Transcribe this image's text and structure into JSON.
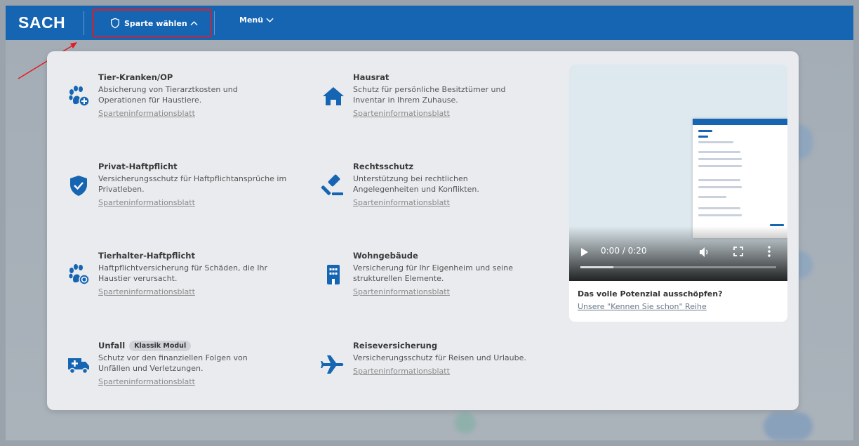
{
  "header": {
    "brand": "SACH",
    "sparte_label": "Sparte wählen",
    "menu_label": "Menü"
  },
  "sparten": [
    {
      "title": "Tier-Kranken/OP",
      "desc": "Absicherung von Tierarztkosten und Operationen für Haustiere.",
      "link": "Sparteninformationsblatt",
      "icon": "paw-plus-icon"
    },
    {
      "title": "Hausrat",
      "desc": "Schutz für persönliche Besitztümer und Inventar in Ihrem Zuhause.",
      "link": "Sparteninformationsblatt",
      "icon": "house-icon"
    },
    {
      "title": "Privat-Haftpflicht",
      "desc": "Versicherungsschutz für Haftpflichtansprüche im Privatleben.",
      "link": "Sparteninformationsblatt",
      "icon": "shield-check-icon"
    },
    {
      "title": "Rechtsschutz",
      "desc": "Unterstützung bei rechtlichen Angelegenheiten und Konflikten.",
      "link": "Sparteninformationsblatt",
      "icon": "gavel-icon"
    },
    {
      "title": "Tierhalter-Haftpflicht",
      "desc": "Haftpflichtversicherung für Schäden, die Ihr Haustier verursacht.",
      "link": "Sparteninformationsblatt",
      "icon": "paw-shield-icon"
    },
    {
      "title": "Wohngebäude",
      "desc": "Versicherung für Ihr Eigenheim und seine strukturellen Elemente.",
      "link": "Sparteninformationsblatt",
      "icon": "building-icon"
    },
    {
      "title": "Unfall",
      "badge": "Klassik Modul",
      "desc": "Schutz vor den finanziellen Folgen von Unfällen und Verletzungen.",
      "link": "Sparteninformationsblatt",
      "icon": "ambulance-icon"
    },
    {
      "title": "Reiseversicherung",
      "desc": "Versicherungsschutz für Reisen und Urlaube.",
      "link": "Sparteninformationsblatt",
      "icon": "airplane-icon"
    }
  ],
  "video": {
    "time": "0:00 / 0:20",
    "progress": 0.17,
    "card_title": "Das volle Potenzial ausschöpfen?",
    "card_link": "Unsere \"Kennen Sie schon\" Reihe"
  },
  "colors": {
    "brand_blue": "#1565b3",
    "highlight_red": "#e41b23"
  }
}
